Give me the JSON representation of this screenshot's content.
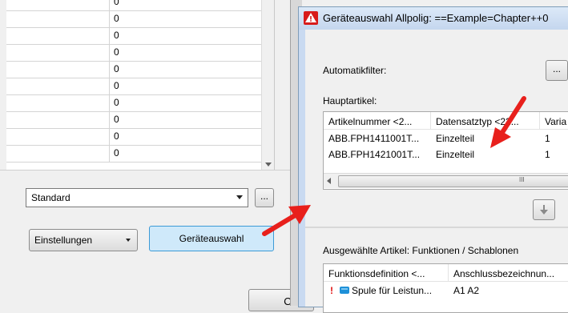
{
  "left_grid": {
    "values": [
      "0",
      "0",
      "0",
      "0",
      "0",
      "0",
      "0",
      "0",
      "0",
      "0"
    ]
  },
  "left_panel": {
    "standard_value": "Standard",
    "browse_button": "...",
    "einstellungen_button": "Einstellungen",
    "geraeteauswahl_button": "Geräteauswahl",
    "ok_button": "OK"
  },
  "dialog": {
    "title": "Geräteauswahl Allpolig: ==Example=Chapter++0",
    "automatikfilter_label": "Automatikfilter:",
    "automatikfilter_button": "...",
    "hauptartikel_label": "Hauptartikel:",
    "hauptartikel_table": {
      "columns": [
        "Artikelnummer <2...",
        "Datensatztyp <22...",
        "Varia"
      ],
      "rows": [
        [
          "ABB.FPH1411001T...",
          "Einzelteil",
          "1"
        ],
        [
          "ABB.FPH1421001T...",
          "Einzelteil",
          "1"
        ]
      ],
      "scroll_thumb": "III"
    },
    "ausgewaehlte_label": "Ausgewählte Artikel: Funktionen / Schablonen",
    "ausgewaehlte_table": {
      "columns": [
        "Funktionsdefinition <...",
        "Anschlussbezeichnun..."
      ],
      "rows": [
        [
          "!",
          "Spule für Leistun...",
          "A1 A2"
        ]
      ]
    }
  },
  "colors": {
    "arrow": "#e8201c",
    "primary_button_border": "#3c9ad6",
    "primary_button_bg": "#cfe9fa",
    "warning": "#e01010",
    "spule_icon": "#1e90d8"
  }
}
